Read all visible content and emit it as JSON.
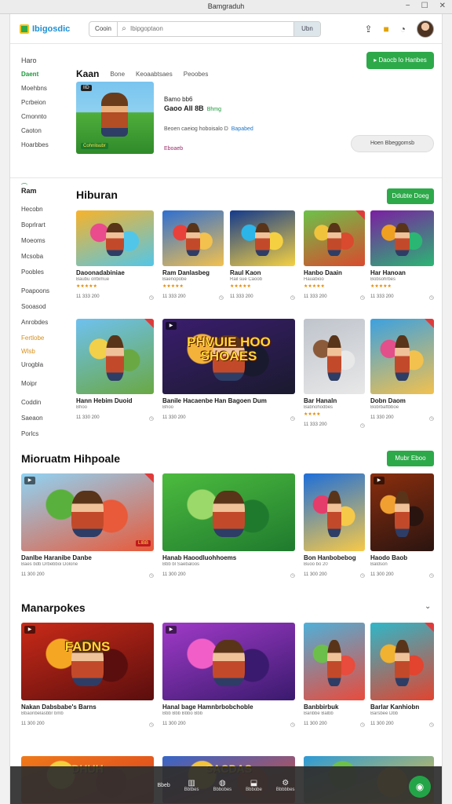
{
  "window": {
    "title": "Bamgraduh"
  },
  "app": {
    "logo_text": "Ibigosdic"
  },
  "search": {
    "scope": "Cooin",
    "placeholder": "Ibipgoptaon",
    "go_label": "Ubn"
  },
  "sidebar": {
    "items_top": [
      "Haro",
      "Daent",
      "Moehbns",
      "Pcrbeion",
      "Cmonnto",
      "Caoton",
      "Hoarbbes"
    ],
    "active_index": 1,
    "heading": "Ram",
    "items_bottom": [
      "Hecobn",
      "Boprlrart",
      "Moeoms",
      "Mcsoba",
      "Poobles",
      "Poapoons",
      "Sooasod",
      "Anrobdes",
      "Fertlobe",
      "Wlsb",
      "Urogbla",
      "Moipr",
      "Coddin",
      "Saeaon",
      "Porlcs"
    ],
    "highlight_indices": [
      8,
      9
    ]
  },
  "tabs": [
    {
      "label": "Kaan",
      "active": true
    },
    {
      "label": "Bone",
      "active": false
    },
    {
      "label": "Keoaabtsaes",
      "active": false
    },
    {
      "label": "Peoobes",
      "active": false
    }
  ],
  "header_button": "Daocb lo Hanbes",
  "hero": {
    "chip": "IID",
    "caption": "Cohnlisubr",
    "line1": "Bamo bb6",
    "line2": "Gaoo AlI 8B",
    "tag": "Bhmg",
    "line3": "Beoen caeiog hoboisalo",
    "line3_num": "D",
    "line3_hl": "Bapabed",
    "line4": "Eboaeb",
    "button": "Hoen Bbeggomsb"
  },
  "sections": {
    "s1": {
      "title": "Hiburan",
      "button": "Ddubte Doeg"
    },
    "s2": {
      "title": "Mioruatm Hihpoale",
      "button": "Mubr Eboo"
    },
    "s3": {
      "title": "Manarpokes"
    }
  },
  "row1": [
    {
      "title": "Daoonadabiniae",
      "meta": "Baubu olrbimue",
      "stars": "★★★★★",
      "count": "11 333 200"
    },
    {
      "title": "Ram Danlasbeg",
      "meta": "Baenopobe",
      "stars": "★★★★★",
      "count": "11 333 200"
    },
    {
      "title": "Raul Kaon",
      "meta": "Rail sue Caoob",
      "stars": "★★★★★",
      "count": "11 333 200"
    },
    {
      "title": "Hanbo Daain",
      "meta": "Hauabioo",
      "stars": "★★★★★",
      "count": "11 333 200"
    },
    {
      "title": "Har Hanoan",
      "meta": "Bobsohrbes",
      "stars": "★★★★★",
      "count": "11 333 200"
    }
  ],
  "row2": [
    {
      "title": "Hann Hebim Duoid",
      "meta": "Bhoo",
      "stars": "",
      "count": "11 330 200",
      "poster": ""
    },
    {
      "title": "Banile Hacaenbe Han Bagoen Dum",
      "meta": "Bhoo",
      "stars": "",
      "count": "11 330 200",
      "poster": "PHVUIE HOO SHOAES"
    },
    {
      "title": "Bar Hanaln",
      "meta": "Babnohodbes",
      "stars": "★★★★",
      "count": "11 333 200",
      "poster": ""
    },
    {
      "title": "Dobn Daom",
      "meta": "Bobrbaftbboe",
      "stars": "",
      "count": "11 330 200",
      "poster": ""
    }
  ],
  "row3": [
    {
      "title": "Danlbe Haranibe Danbe",
      "meta": "Baes bdb Drbebboi Dolone",
      "count": "11 300 200",
      "label": "LIBB"
    },
    {
      "title": "Hanab Haoodluohhoems",
      "meta": "Bbb bl Saebaloos",
      "count": "11 300 200",
      "label": ""
    },
    {
      "title": "Bon Hanbobebog",
      "meta": "Buoo bo 20",
      "count": "11 300 200",
      "label": ""
    },
    {
      "title": "Haodo Baob",
      "meta": "Baldson",
      "count": "11 300 200",
      "label": ""
    }
  ],
  "row4": [
    {
      "title": "Nakan Dabsbabe's Barns",
      "meta": "Bbaonbelasbbr bmb",
      "count": "11 300 200",
      "poster": "FADNS"
    },
    {
      "title": "Hanal bage Hamnbrbobchoble",
      "meta": "Bbb Bbb Bbbo Bbb",
      "count": "11 300 200",
      "poster": ""
    },
    {
      "title": "Banbbirbuk",
      "meta": "Banbbe Balbb",
      "count": "11 300 200",
      "poster": ""
    },
    {
      "title": "Barlar Kanhiobn",
      "meta": "Barsbee Dbb",
      "count": "11 300 200",
      "poster": ""
    }
  ],
  "row5_posters": [
    "DHUH",
    "SACDAS",
    ""
  ],
  "bottom_bar": {
    "label": "Bbeb",
    "items": [
      "Bbtbes",
      "Bbbobes",
      "Bbbobe",
      "Bbbbbes"
    ]
  },
  "colors": {
    "accent": "#2da94a",
    "brand": "#1c8fd3"
  }
}
